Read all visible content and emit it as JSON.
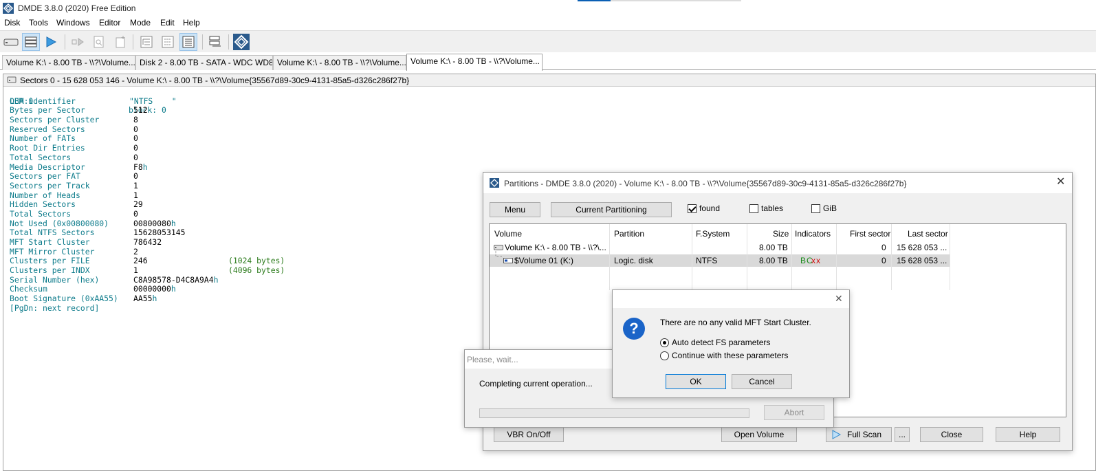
{
  "app": {
    "title": "DMDE 3.8.0 (2020) Free Edition"
  },
  "menu": [
    "Disk",
    "Tools",
    "Windows",
    "Editor",
    "Mode",
    "Edit",
    "Help"
  ],
  "tabs": [
    "Volume K:\\ - 8.00 TB - \\\\?\\Volume...",
    "Disk 2 - 8.00 TB - SATA - WDC WD8...",
    "Volume K:\\ - 8.00 TB - \\\\?\\Volume...",
    "Volume K:\\ - 8.00 TB - \\\\?\\Volume..."
  ],
  "pane_header": "Sectors 0 - 15 628 053 146 - Volume K:\\ - 8.00 TB - \\\\?\\Volume{35567d89-30c9-4131-85a5-d326c286f27b}",
  "record": {
    "lba": "LBA:0",
    "block": "block: 0",
    "rows": [
      {
        "label": "OEM identifier",
        "value": "\"NTFS    \"",
        "teal": true
      },
      {
        "label": "Bytes per Sector",
        "value": "512"
      },
      {
        "label": "Sectors per Cluster",
        "value": "8"
      },
      {
        "label": "Reserved Sectors",
        "value": "0"
      },
      {
        "label": "Number of FATs",
        "value": "0"
      },
      {
        "label": "Root Dir Entries",
        "value": "0"
      },
      {
        "label": "Total Sectors",
        "value": "0"
      },
      {
        "label": "Media Descriptor",
        "value": "F8",
        "suffix": "h"
      },
      {
        "label": "Sectors per FAT",
        "value": "0"
      },
      {
        "label": "Sectors per Track",
        "value": "1"
      },
      {
        "label": "Number of Heads",
        "value": "1"
      },
      {
        "label": "Hidden Sectors",
        "value": "29"
      },
      {
        "label": "Total Sectors",
        "value": "0"
      },
      {
        "label": "Not Used (0x00800080)",
        "value": "00800080",
        "suffix": "h"
      },
      {
        "label": "Total NTFS Sectors",
        "value": "15628053145"
      },
      {
        "label": "MFT Start Cluster",
        "value": "786432"
      },
      {
        "label": "MFT Mirror Cluster",
        "value": "2"
      },
      {
        "label": "Clusters per FILE",
        "value": "246",
        "note": "(1024 bytes)"
      },
      {
        "label": "Clusters per INDX",
        "value": "1",
        "note": "(4096 bytes)"
      },
      {
        "label": "Serial Number (hex)",
        "value": "C8A98578-D4C8A9A4",
        "suffix": "h"
      },
      {
        "label": "Checksum",
        "value": "00000000",
        "suffix": "h"
      },
      {
        "label": "Boot Signature (0xAA55)",
        "value": "AA55",
        "suffix": "h"
      }
    ],
    "next": "[PgDn: next record]"
  },
  "partitions": {
    "title": "Partitions - DMDE 3.8.0 (2020) - Volume K:\\ - 8.00 TB - \\\\?\\Volume{35567d89-30c9-4131-85a5-d326c286f27b}",
    "menu_btn": "Menu",
    "current_btn": "Current Partitioning",
    "found": "found",
    "tables": "tables",
    "gib": "GiB",
    "columns": {
      "volume": "Volume",
      "partition": "Partition",
      "fs": "F.System",
      "size": "Size",
      "indicators": "Indicators",
      "first": "First sector",
      "last": "Last sector"
    },
    "rows": [
      {
        "volume": "Volume K:\\ - 8.00 TB - \\\\?\\...",
        "partition": "",
        "fs": "",
        "size": "8.00 TB",
        "indicators_b": "",
        "indicators_x": "",
        "first": "0",
        "last": "15 628 053 ..."
      },
      {
        "volume": "$Volume 01 (K:)",
        "partition": "Logic. disk",
        "fs": "NTFS",
        "size": "8.00 TB",
        "indicators_b": "BC",
        "indicators_x": "xx",
        "first": "0",
        "last": "15 628 053 ..."
      }
    ],
    "vbr_btn": "VBR On/Off",
    "open_btn": "Open Volume",
    "full_scan_btn": "Full Scan",
    "more_btn": "...",
    "close_btn": "Close",
    "help_btn": "Help"
  },
  "wait": {
    "title": "Please, wait...",
    "message": "Completing current operation...",
    "abort": "Abort",
    "progress": 0
  },
  "msg": {
    "text": "There are no any valid MFT Start Cluster.",
    "opt1": "Auto detect FS parameters",
    "opt2": "Continue with these parameters",
    "ok": "OK",
    "cancel": "Cancel"
  }
}
